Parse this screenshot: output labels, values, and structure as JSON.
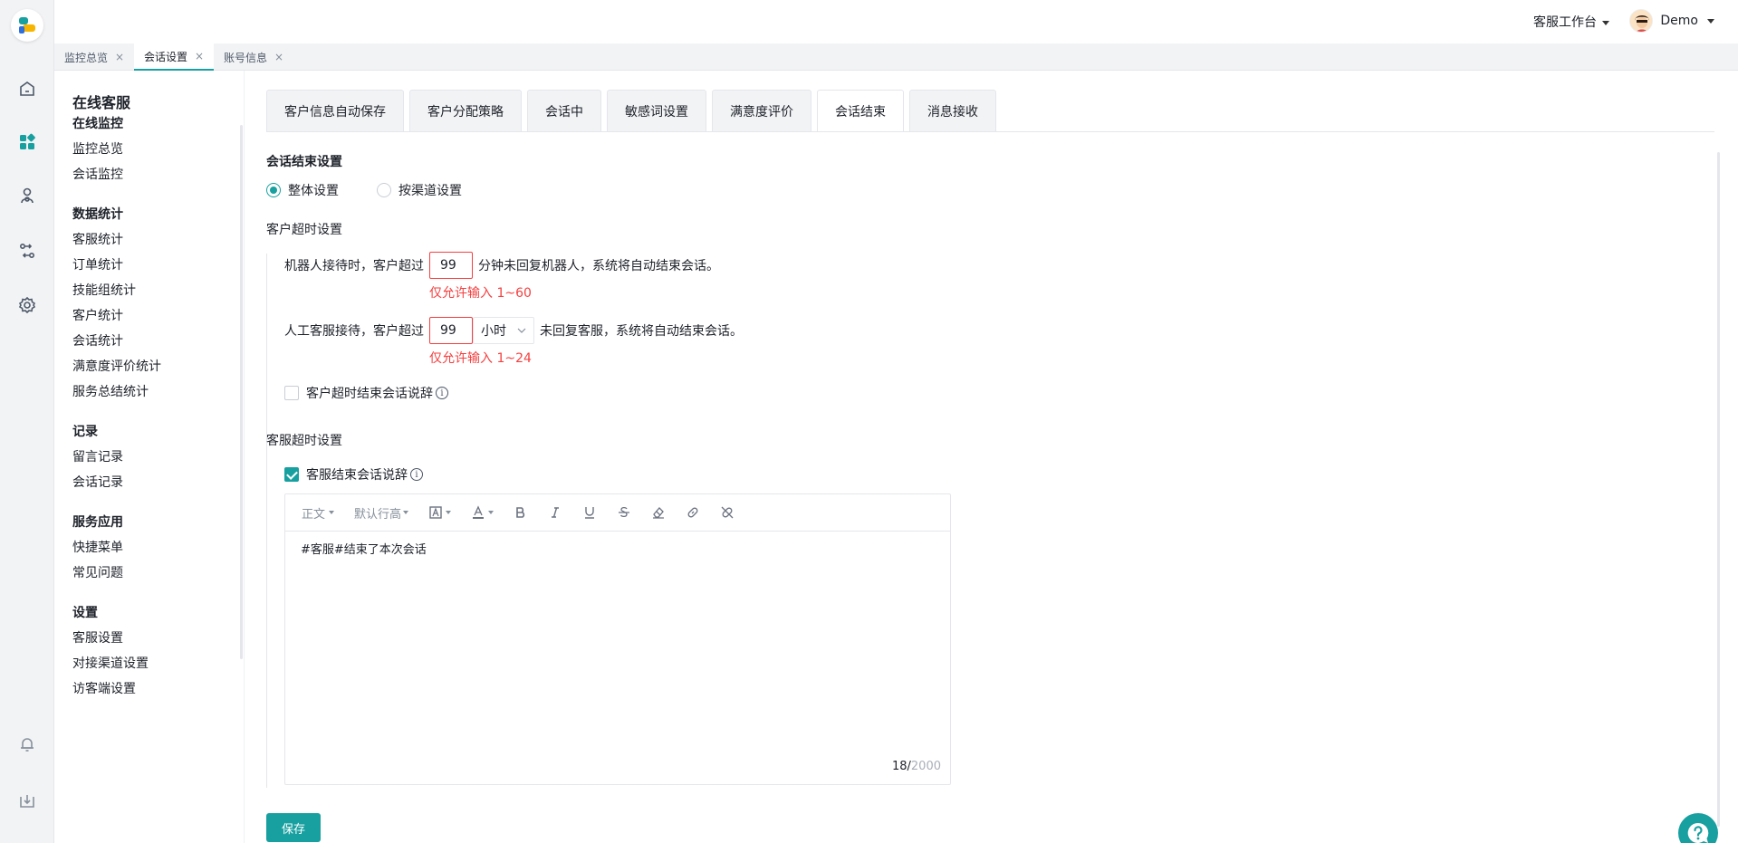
{
  "header": {
    "workbench_label": "客服工作台",
    "user_name": "Demo"
  },
  "page_tabs": [
    {
      "label": "监控总览",
      "close": "×"
    },
    {
      "label": "会话设置",
      "close": "×"
    },
    {
      "label": "账号信息",
      "close": "×"
    }
  ],
  "rail_icons": [
    "home-icon",
    "dashboard-icon",
    "contacts-icon",
    "routing-icon",
    "settings-icon",
    "bell-icon",
    "download-icon"
  ],
  "menu": {
    "title": "在线客服",
    "groups": [
      {
        "label": "在线监控",
        "items": [
          "监控总览",
          "会话监控"
        ]
      },
      {
        "label": "数据统计",
        "items": [
          "客服统计",
          "订单统计",
          "技能组统计",
          "客户统计",
          "会话统计",
          "满意度评价统计",
          "服务总结统计"
        ]
      },
      {
        "label": "记录",
        "items": [
          "留言记录",
          "会话记录"
        ]
      },
      {
        "label": "服务应用",
        "items": [
          "快捷菜单",
          "常见问题"
        ]
      },
      {
        "label": "设置",
        "items": [
          "客服设置",
          "对接渠道设置",
          "访客端设置"
        ]
      }
    ]
  },
  "settings_tabs": [
    "客户信息自动保存",
    "客户分配策略",
    "会话中",
    "敏感词设置",
    "满意度评价",
    "会话结束",
    "消息接收"
  ],
  "active_settings_tab": "会话结束",
  "end_settings": {
    "title": "会话结束设置",
    "mode_options": [
      "整体设置",
      "按渠道设置"
    ],
    "selected_mode": "整体设置"
  },
  "customer_timeout": {
    "title": "客户超时设置",
    "robot_prefix": "机器人接待时，客户超过",
    "robot_value": "99",
    "robot_suffix": "分钟未回复机器人，系统将自动结束会话。",
    "robot_error": "仅允许输入 1~60",
    "human_prefix": "人工客服接待，客户超过",
    "human_value": "99",
    "human_unit": "小时",
    "human_suffix": "未回复客服，系统将自动结束会话。",
    "human_error": "仅允许输入 1~24",
    "phrase_label": "客户超时结束会话说辞",
    "phrase_checked": false
  },
  "agent_timeout": {
    "title": "客服超时设置",
    "phrase_label": "客服结束会话说辞",
    "phrase_checked": true
  },
  "editor": {
    "toolbar": {
      "text_style": "正文",
      "line_height": "默认行高"
    },
    "content": "#客服#结束了本次会话",
    "count": "18",
    "max": "2000"
  },
  "save_label": "保存",
  "colors": {
    "accent": "#18a0a0",
    "error": "#f53f3f"
  }
}
